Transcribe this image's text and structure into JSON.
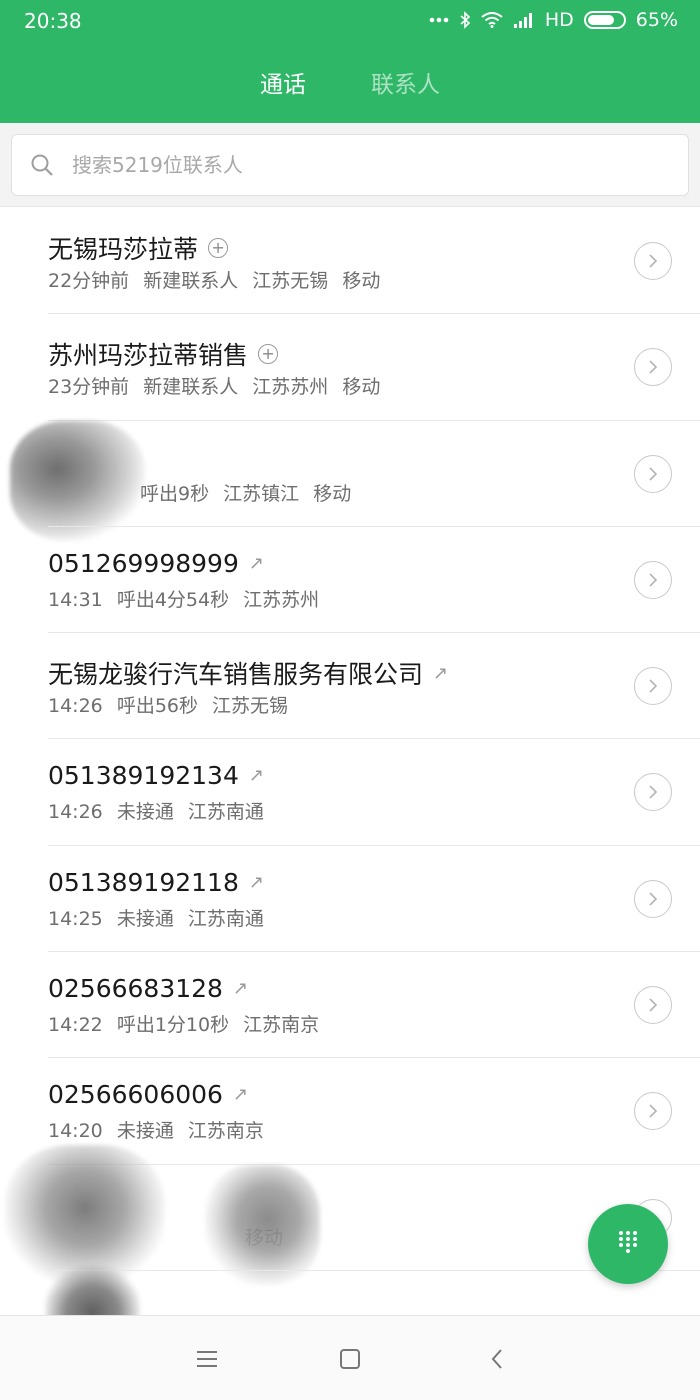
{
  "status_bar": {
    "time": "20:38",
    "network": "HD",
    "battery": "65%"
  },
  "tabs": [
    {
      "label": "通话",
      "active": true
    },
    {
      "label": "联系人",
      "active": false
    }
  ],
  "search": {
    "placeholder": "搜索5219位联系人"
  },
  "calls": [
    {
      "name": "无锡玛莎拉蒂",
      "icon": "add-contact-icon",
      "details": [
        "22分钟前",
        "新建联系人",
        "江苏无锡",
        "移动"
      ]
    },
    {
      "name": "苏州玛莎拉蒂销售",
      "icon": "add-contact-icon",
      "details": [
        "23分钟前",
        "新建联系人",
        "江苏苏州",
        "移动"
      ]
    },
    {
      "name": "",
      "icon": "",
      "details": [
        "呼出9秒",
        "江苏镇江",
        "移动"
      ],
      "redacted": true
    },
    {
      "name": "051269998999",
      "icon": "outgoing-call-icon",
      "details": [
        "14:31",
        "呼出4分54秒",
        "江苏苏州"
      ]
    },
    {
      "name": "无锡龙骏行汽车销售服务有限公司",
      "icon": "outgoing-call-icon",
      "details": [
        "14:26",
        "呼出56秒",
        "江苏无锡"
      ]
    },
    {
      "name": "051389192134",
      "icon": "outgoing-call-icon",
      "details": [
        "14:26",
        "未接通",
        "江苏南通"
      ]
    },
    {
      "name": "051389192118",
      "icon": "outgoing-call-icon",
      "details": [
        "14:25",
        "未接通",
        "江苏南通"
      ]
    },
    {
      "name": "02566683128",
      "icon": "outgoing-call-icon",
      "details": [
        "14:22",
        "呼出1分10秒",
        "江苏南京"
      ]
    },
    {
      "name": "02566606006",
      "icon": "outgoing-call-icon",
      "details": [
        "14:20",
        "未接通",
        "江苏南京"
      ]
    },
    {
      "name": "",
      "icon": "",
      "details": [
        "移动"
      ],
      "redacted": true
    }
  ],
  "colors": {
    "accent": "#2fb768"
  }
}
